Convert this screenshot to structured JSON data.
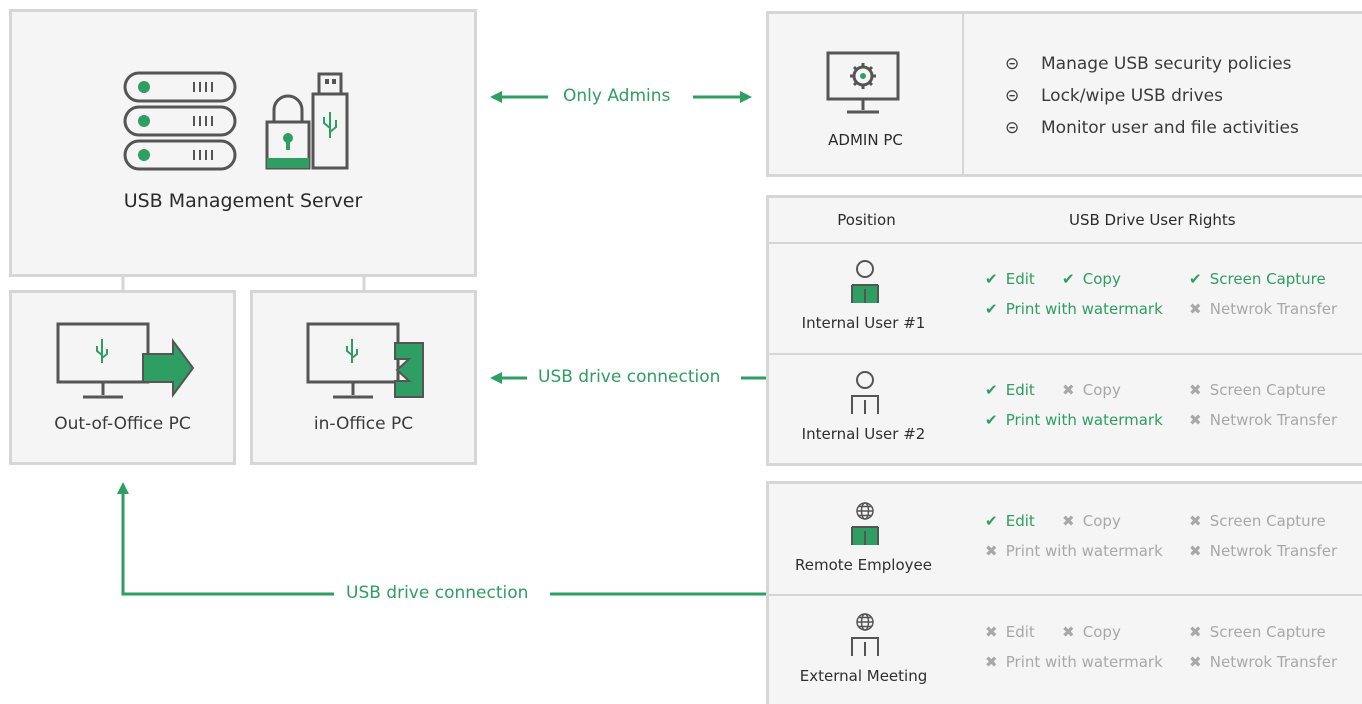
{
  "server": {
    "label": "USB Management Server"
  },
  "admin_link": {
    "label": "Only Admins"
  },
  "admin_pc": {
    "label": "ADMIN PC",
    "features": [
      "Manage USB security policies",
      "Lock/wipe USB drives",
      "Monitor user and file activities"
    ]
  },
  "pcs": {
    "out_of_office": "Out-of-Office PC",
    "in_office": "in-Office PC"
  },
  "connections": {
    "usb_mid": "USB drive connection",
    "usb_bottom": "USB drive connection"
  },
  "table": {
    "headers": {
      "position": "Position",
      "rights": "USB Drive User Rights"
    },
    "rows": [
      {
        "name": "Internal User #1",
        "rights": [
          {
            "label": "Edit",
            "allowed": true
          },
          {
            "label": "Copy",
            "allowed": true
          },
          {
            "label": "Screen Capture",
            "allowed": true
          },
          {
            "label": "Print with watermark",
            "allowed": true
          },
          {
            "label": "Netwrok Transfer",
            "allowed": false
          }
        ]
      },
      {
        "name": "Internal User #2",
        "rights": [
          {
            "label": "Edit",
            "allowed": true
          },
          {
            "label": "Copy",
            "allowed": false
          },
          {
            "label": "Screen Capture",
            "allowed": false
          },
          {
            "label": "Print with watermark",
            "allowed": true
          },
          {
            "label": "Netwrok Transfer",
            "allowed": false
          }
        ]
      },
      {
        "name": "Remote Employee",
        "rights": [
          {
            "label": "Edit",
            "allowed": true
          },
          {
            "label": "Copy",
            "allowed": false
          },
          {
            "label": "Screen Capture",
            "allowed": false
          },
          {
            "label": "Print with watermark",
            "allowed": false
          },
          {
            "label": "Netwrok Transfer",
            "allowed": false
          }
        ]
      },
      {
        "name": "External Meeting",
        "rights": [
          {
            "label": "Edit",
            "allowed": false
          },
          {
            "label": "Copy",
            "allowed": false
          },
          {
            "label": "Screen Capture",
            "allowed": false
          },
          {
            "label": "Print with watermark",
            "allowed": false
          },
          {
            "label": "Netwrok Transfer",
            "allowed": false
          }
        ]
      }
    ]
  },
  "marks": {
    "allowed": "✔",
    "denied": "✖"
  },
  "bullet": "⊝",
  "colors": {
    "accent": "#2e9e62",
    "denied": "#a8a8a8",
    "border": "#d6d6d6",
    "panel": "#f5f5f5",
    "icon": "#555555"
  },
  "icons": [
    "server-rack-icon",
    "padlock-icon",
    "usb-stick-icon",
    "monitor-gear-icon",
    "monitor-usb-export-icon",
    "monitor-usb-import-icon",
    "user-icon",
    "globe-user-icon"
  ]
}
